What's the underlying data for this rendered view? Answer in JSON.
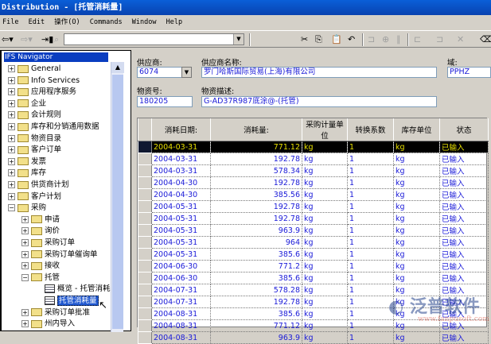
{
  "window": {
    "title": "Distribution - [托管消耗量]"
  },
  "menu": [
    "File",
    "Edit",
    "操作(O)",
    "Commands",
    "Window",
    "Help"
  ],
  "navigator": {
    "title": "IFS Navigator",
    "items": [
      {
        "label": "General",
        "level": 0,
        "state": "+"
      },
      {
        "label": "Info Services",
        "level": 0,
        "state": "+"
      },
      {
        "label": "应用程序服务",
        "level": 0,
        "state": "+"
      },
      {
        "label": "企业",
        "level": 0,
        "state": "+"
      },
      {
        "label": "会计规则",
        "level": 0,
        "state": "+"
      },
      {
        "label": "库存和分销通用数据",
        "level": 0,
        "state": "+"
      },
      {
        "label": "物资目录",
        "level": 0,
        "state": "+"
      },
      {
        "label": "客户订单",
        "level": 0,
        "state": "+"
      },
      {
        "label": "发票",
        "level": 0,
        "state": "+"
      },
      {
        "label": "库存",
        "level": 0,
        "state": "+"
      },
      {
        "label": "供货商计划",
        "level": 0,
        "state": "+"
      },
      {
        "label": "客户计划",
        "level": 0,
        "state": "+"
      },
      {
        "label": "采购",
        "level": 0,
        "state": "-"
      },
      {
        "label": "申请",
        "level": 1,
        "state": "+"
      },
      {
        "label": "询价",
        "level": 1,
        "state": "+"
      },
      {
        "label": "采购订单",
        "level": 1,
        "state": "+"
      },
      {
        "label": "采购订单催询单",
        "level": 1,
        "state": "+"
      },
      {
        "label": "接收",
        "level": 1,
        "state": "+"
      },
      {
        "label": "托管",
        "level": 1,
        "state": "-"
      },
      {
        "label": "概览 - 托管消耗",
        "level": 2,
        "state": "doc"
      },
      {
        "label": "托管消耗量",
        "level": 2,
        "state": "doc-selected"
      },
      {
        "label": "采购订单批准",
        "level": 1,
        "state": "+"
      },
      {
        "label": "州内导入",
        "level": 1,
        "state": "+"
      }
    ]
  },
  "form": {
    "supplier_label": "供应商:",
    "supplier": "6074",
    "supplier_name_label": "供应商名称:",
    "supplier_name": "罗门哈斯国际贸易(上海)有限公司",
    "site_label": "域:",
    "site": "PPHZ",
    "part_no_label": "物资号:",
    "part_no": "180205",
    "part_desc_label": "物资描述:",
    "part_desc": "G-AD37R987底涂@-(托管)"
  },
  "grid": {
    "columns": [
      "消耗日期:",
      "消耗量:",
      "采购计量单位",
      "转换系数",
      "库存单位",
      "状态"
    ],
    "rows": [
      [
        "2004-03-31",
        "771.12",
        "kg",
        "1",
        "kg",
        "已输入"
      ],
      [
        "2004-03-31",
        "192.78",
        "kg",
        "1",
        "kg",
        "已输入"
      ],
      [
        "2004-03-31",
        "578.34",
        "kg",
        "1",
        "kg",
        "已输入"
      ],
      [
        "2004-04-30",
        "192.78",
        "kg",
        "1",
        "kg",
        "已输入"
      ],
      [
        "2004-04-30",
        "385.56",
        "kg",
        "1",
        "kg",
        "已输入"
      ],
      [
        "2004-05-31",
        "192.78",
        "kg",
        "1",
        "kg",
        "已输入"
      ],
      [
        "2004-05-31",
        "192.78",
        "kg",
        "1",
        "kg",
        "已输入"
      ],
      [
        "2004-05-31",
        "963.9",
        "kg",
        "1",
        "kg",
        "已输入"
      ],
      [
        "2004-05-31",
        "964",
        "kg",
        "1",
        "kg",
        "已输入"
      ],
      [
        "2004-05-31",
        "385.6",
        "kg",
        "1",
        "kg",
        "已输入"
      ],
      [
        "2004-06-30",
        "771.2",
        "kg",
        "1",
        "kg",
        "已输入"
      ],
      [
        "2004-06-30",
        "385.6",
        "kg",
        "1",
        "kg",
        "已输入"
      ],
      [
        "2004-07-31",
        "578.28",
        "kg",
        "1",
        "kg",
        "已输入"
      ],
      [
        "2004-07-31",
        "192.78",
        "kg",
        "1",
        "kg",
        "已输入"
      ],
      [
        "2004-08-31",
        "385.6",
        "kg",
        "1",
        "kg",
        "已输入"
      ],
      [
        "2004-08-31",
        "771.12",
        "kg",
        "1",
        "kg",
        "已输入"
      ],
      [
        "2004-08-31",
        "963.9",
        "kg",
        "1",
        "kg",
        "已输入"
      ]
    ]
  },
  "watermark": {
    "text": "泛普软件",
    "url": "www.fanpusoft.com"
  }
}
